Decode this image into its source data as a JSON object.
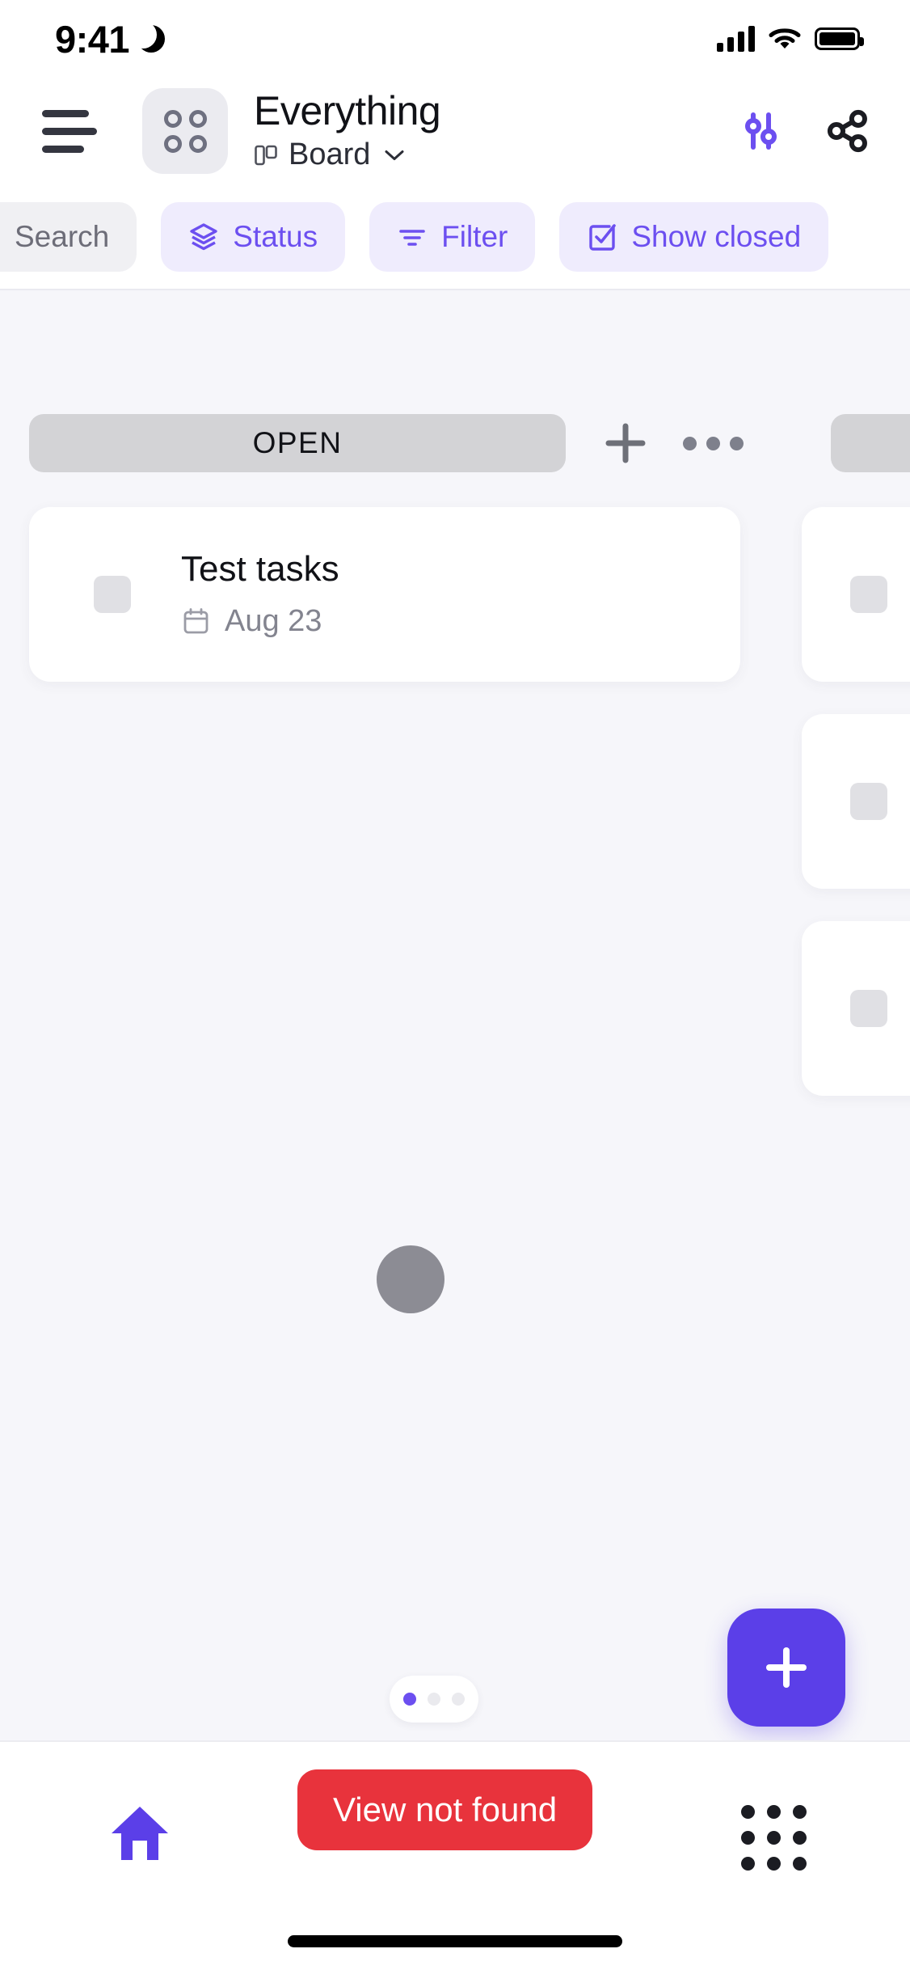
{
  "status_bar": {
    "time": "9:41",
    "dnd_icon": "moon-icon",
    "signal_icon": "cellular-bars-icon",
    "wifi_icon": "wifi-icon",
    "battery_icon": "battery-full-icon"
  },
  "header": {
    "menu_icon": "hamburger-menu-icon",
    "app_icon": "grid-dots-app-icon",
    "title": "Everything",
    "view_icon": "board-layout-icon",
    "view_label": "Board",
    "view_chevron_icon": "chevron-down-icon",
    "settings_icon": "sliders-icon",
    "share_icon": "share-icon"
  },
  "chips": [
    {
      "label": "Search",
      "icon": null,
      "style": "search",
      "name": "search-chip"
    },
    {
      "label": "Status",
      "icon": "layers-icon",
      "style": "accent",
      "name": "status-chip"
    },
    {
      "label": "Filter",
      "icon": "filter-lines-icon",
      "style": "accent",
      "name": "filter-chip"
    },
    {
      "label": "Show closed",
      "icon": "checkbox-check-icon",
      "style": "accent",
      "name": "show-closed-chip"
    }
  ],
  "board": {
    "column": {
      "label": "OPEN",
      "add_icon": "plus-icon",
      "more_icon": "ellipsis-icon"
    },
    "cards": [
      {
        "title": "Test tasks",
        "date_icon": "calendar-icon",
        "date": "Aug 23"
      }
    ],
    "page_indicator": {
      "total": 3,
      "active": 1
    },
    "fab_icon": "plus-icon"
  },
  "bottom_bar": {
    "home_icon": "home-icon",
    "apps_icon": "grid-apps-icon",
    "toast_label": "View not found",
    "toast_color": "#e8333c"
  },
  "colors": {
    "accent": "#6c4ff0",
    "accent_strong": "#5b3fe8",
    "chip_bg": "#efecfd",
    "board_bg": "#f6f6fa",
    "column_pill": "#d3d3d6",
    "error": "#e8333c"
  }
}
